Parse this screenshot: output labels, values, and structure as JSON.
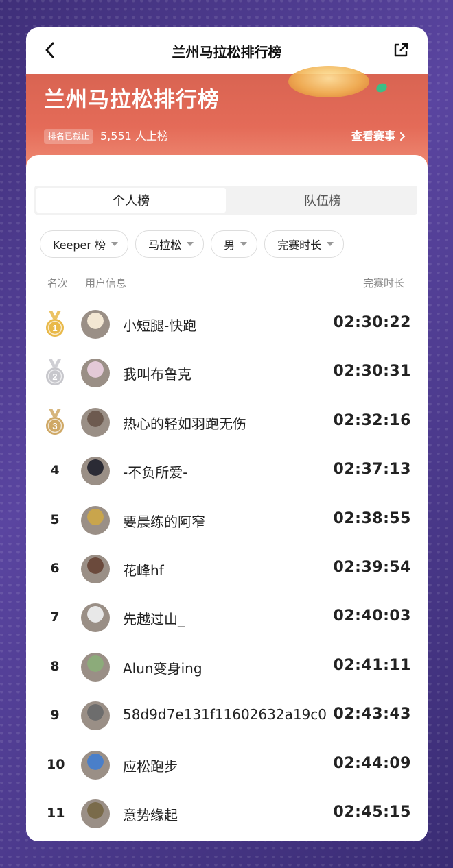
{
  "nav": {
    "title": "兰州马拉松排行榜"
  },
  "hero": {
    "title": "兰州马拉松排行榜",
    "badge": "排名已截止",
    "count": "5,551 人上榜",
    "view_event": "查看赛事"
  },
  "tabs": [
    {
      "label": "个人榜",
      "active": true
    },
    {
      "label": "队伍榜",
      "active": false
    }
  ],
  "filters": [
    "Keeper 榜",
    "马拉松",
    "男",
    "完赛时长"
  ],
  "headers": {
    "rank": "名次",
    "user": "用户信息",
    "time": "完赛时长"
  },
  "rows": [
    {
      "rank": "1",
      "name": "小短腿-快跑",
      "time": "02:30:22",
      "medal": "gold"
    },
    {
      "rank": "2",
      "name": "我叫布鲁克",
      "time": "02:30:31",
      "medal": "silver"
    },
    {
      "rank": "3",
      "name": "热心的轻如羽跑无伤",
      "time": "02:32:16",
      "medal": "bronze"
    },
    {
      "rank": "4",
      "name": "-不负所爱-",
      "time": "02:37:13"
    },
    {
      "rank": "5",
      "name": "要晨练的阿窄",
      "time": "02:38:55"
    },
    {
      "rank": "6",
      "name": "花峰hf",
      "time": "02:39:54"
    },
    {
      "rank": "7",
      "name": "先越过山_",
      "time": "02:40:03"
    },
    {
      "rank": "8",
      "name": "Alun变身ing",
      "time": "02:41:11"
    },
    {
      "rank": "9",
      "name": "58d9d7e131f11602632a19c0",
      "time": "02:43:43"
    },
    {
      "rank": "10",
      "name": "应松跑步",
      "time": "02:44:09"
    },
    {
      "rank": "11",
      "name": "意势缘起",
      "time": "02:45:15"
    }
  ],
  "colors": {
    "hero": "#e46b58",
    "gold": "#e9b949",
    "silver": "#c7c7cc",
    "bronze": "#cfa865"
  }
}
